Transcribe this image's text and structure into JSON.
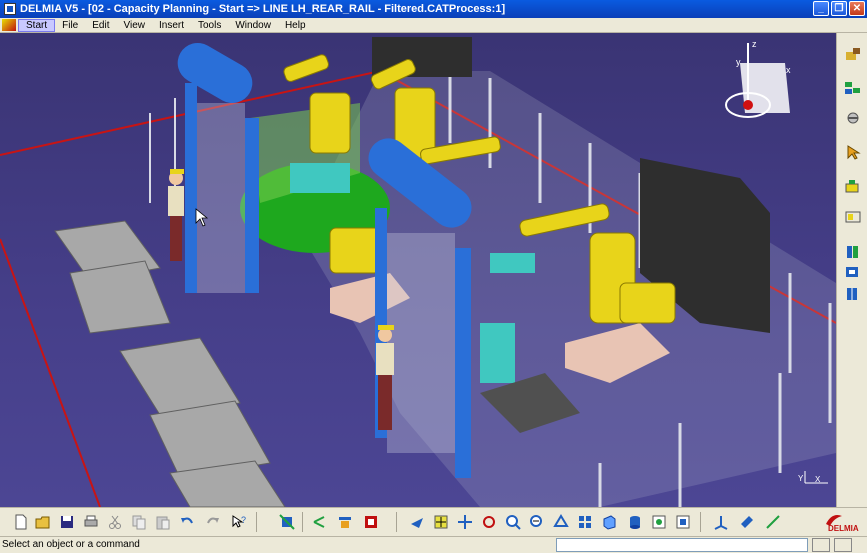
{
  "window": {
    "title": "DELMIA V5 - [02 - Capacity Planning - Start => LINE LH_REAR_RAIL - Filtered.CATProcess:1]",
    "minimize_glyph": "_",
    "restore_glyph": "❐",
    "close_glyph": "✕"
  },
  "menu": {
    "items": [
      "Start",
      "File",
      "Edit",
      "View",
      "Insert",
      "Tools",
      "Window",
      "Help"
    ]
  },
  "compass": {
    "x_label": "x",
    "y_label": "y",
    "z_label": "z"
  },
  "axis_indicator": {
    "x_label": "X",
    "y_label": "Y"
  },
  "right_toolbar": {
    "icons": [
      "workcell-icon",
      "resource-tree-icon",
      "robot-teach-icon",
      "select-arrow-icon",
      "device-building-icon",
      "layout-icon",
      "library-icon",
      "catalog-icon",
      "book-icon"
    ]
  },
  "bottom_toolbar": {
    "icons": [
      "new-icon",
      "open-icon",
      "save-icon",
      "print-icon",
      "cut-icon",
      "copy-icon",
      "paste-icon",
      "undo-icon",
      "redo-icon",
      "whats-this-icon",
      "fit-all-icon",
      "tree-expand-icon",
      "product-icon",
      "insert-icon",
      "fly-icon",
      "pan-icon",
      "rotate-icon",
      "zoom-in-icon",
      "zoom-out-icon",
      "normal-view-icon",
      "multi-view-icon",
      "iso-view-icon",
      "shading-icon",
      "cylinder-view-icon",
      "render-icon",
      "hide-show-icon",
      "compass-icon",
      "measure-icon",
      "snap-icon"
    ],
    "brand": "DELMIA"
  },
  "status": {
    "message": "Select an object or a command",
    "command_value": ""
  },
  "colors": {
    "titlebar": "#0a4fd0",
    "robot": "#e8d41a",
    "frame": "#2a6fd8",
    "floor": "#463f8a",
    "fence": "#cfd2e0",
    "red_boundary": "#c81414"
  }
}
